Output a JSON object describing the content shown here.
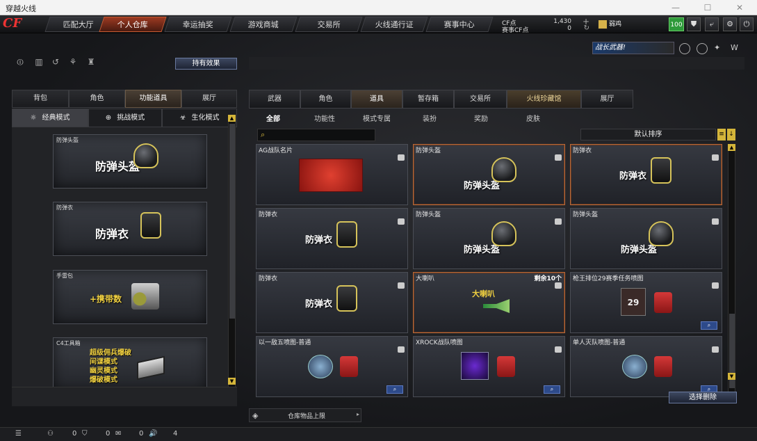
{
  "window": {
    "title": "穿越火线"
  },
  "nav": [
    "匹配大厅",
    "个人仓库",
    "幸运抽奖",
    "游戏商城",
    "交易所",
    "火线通行证",
    "赛事中心"
  ],
  "nav_active": 1,
  "currency": {
    "cf_label": "CF点",
    "cf_value": "1,430",
    "match_label": "赛事CF点",
    "match_value": "0"
  },
  "rank": {
    "name": "弱鸡"
  },
  "level": "100",
  "banner": {
    "text": "战长武器!"
  },
  "left": {
    "effect_button": "持有效果",
    "tabs": [
      "背包",
      "角色",
      "功能道具",
      "展厅"
    ],
    "tab_active": 2,
    "modes": [
      "经典模式",
      "挑战模式",
      "生化模式"
    ],
    "mode_active": 0,
    "cards": [
      {
        "caption": "防弹头盔",
        "label": "防弹头盔"
      },
      {
        "caption": "防弹衣",
        "label": "防弹衣"
      },
      {
        "caption": "手雷包",
        "label": "+携带数"
      },
      {
        "caption": "C4工具箱",
        "lines": [
          "超级佣兵爆破",
          "间谍模式",
          "幽灵模式",
          "爆破模式"
        ]
      }
    ]
  },
  "right": {
    "tabs": [
      "武器",
      "角色",
      "道具",
      "暂存箱",
      "交易所",
      "火线珍藏馆",
      "展厅"
    ],
    "tab_active": 2,
    "subtabs": [
      "全部",
      "功能性",
      "模式专属",
      "装扮",
      "奖励",
      "皮肤"
    ],
    "sub_active": 0,
    "sort": "默认排序",
    "items": [
      {
        "caption": "AG战队名片",
        "kind": "ag"
      },
      {
        "caption": "防弹头盔",
        "label": "防弹头盔",
        "kind": "helmet",
        "selected": true
      },
      {
        "caption": "防弹衣",
        "label": "防弹衣",
        "kind": "vest",
        "selected": true
      },
      {
        "caption": "防弹衣",
        "label": "防弹衣",
        "kind": "vest"
      },
      {
        "caption": "防弹头盔",
        "label": "防弹头盔",
        "kind": "helmet"
      },
      {
        "caption": "防弹头盔",
        "label": "防弹头盔",
        "kind": "helmet"
      },
      {
        "caption": "防弹衣",
        "label": "防弹衣",
        "kind": "vest"
      },
      {
        "caption": "大喇叭",
        "label": "大喇叭",
        "remain": "剩余10个",
        "kind": "horn",
        "selected": true
      },
      {
        "caption": "枪王排位29赛季任务喷图",
        "badge": "29",
        "kind": "spray29",
        "search": true
      },
      {
        "caption": "以一敌五喷图-普通",
        "kind": "spray",
        "search": true
      },
      {
        "caption": "XROCK战队喷图",
        "kind": "xrock",
        "search": true
      },
      {
        "caption": "单人灭队喷图-普通",
        "kind": "spray",
        "search": true
      }
    ],
    "select_delete": "选择删除",
    "storage_limit": "仓库物品上限"
  },
  "bottom": {
    "c1": "0",
    "c2": "0",
    "c3": "0",
    "c4": "4"
  }
}
